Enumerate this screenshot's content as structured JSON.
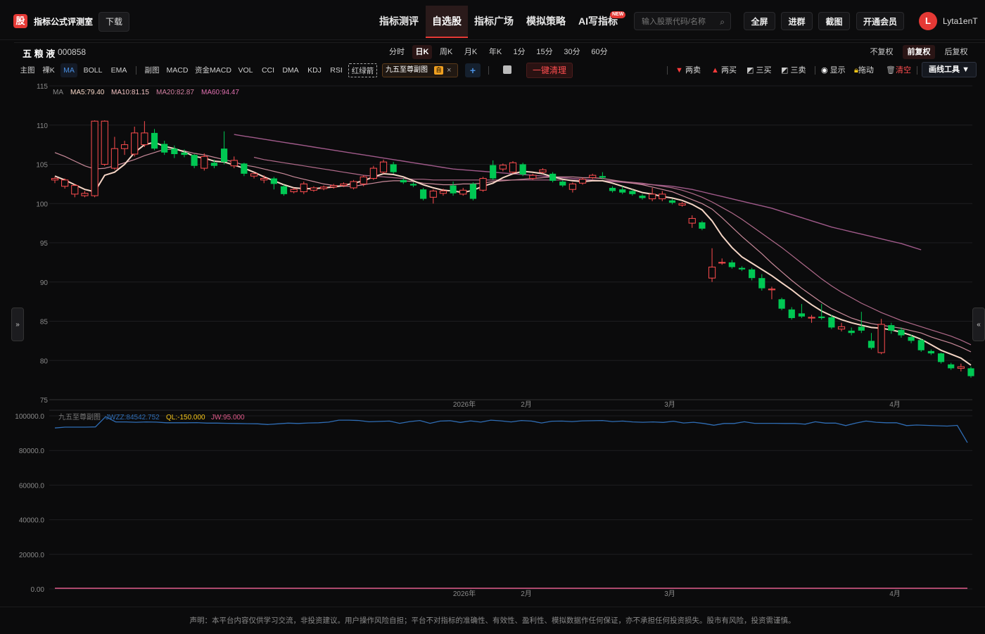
{
  "header": {
    "logo_char": "股",
    "brand": "指标公式评测室",
    "download": "下载",
    "nav": [
      "指标测评",
      "自选股",
      "指标广场",
      "模拟策略",
      "AI写指标"
    ],
    "active_nav": 1,
    "new_badge": "NEW",
    "search_placeholder": "输入股票代码/名称",
    "buttons": [
      "全屏",
      "进群",
      "截图",
      "开通会员"
    ],
    "avatar_letter": "L",
    "username": "Lyta1enT"
  },
  "stock": {
    "name": "五 粮 液",
    "code": "000858"
  },
  "periods": [
    "分时",
    "日K",
    "周K",
    "月K",
    "年K",
    "1分",
    "15分",
    "30分",
    "60分"
  ],
  "active_period": 1,
  "adjust": [
    "不复权",
    "前复权",
    "后复权"
  ],
  "active_adjust": 1,
  "indicators": [
    "主图",
    "裸K",
    "MA",
    "BOLL",
    "EMA",
    "副图",
    "MACD",
    "资金MACD",
    "VOL",
    "CCI",
    "DMA",
    "KDJ",
    "RSI",
    "红绿箭"
  ],
  "active_indicator": 2,
  "chip": {
    "label": "九五至尊副图",
    "tag": "自"
  },
  "clear_all": "一键清理",
  "tools": [
    "两卖",
    "两买",
    "三买",
    "三卖",
    "显示",
    "拖动",
    "清空"
  ],
  "draw_tools": "画线工具 ▼",
  "ma_legend": {
    "label": "MA",
    "ma5": "MA5:79.40",
    "ma10": "MA10:81.15",
    "ma20": "MA20:82.87",
    "ma60": "MA60:94.47"
  },
  "sub_legend": {
    "label": "九五至尊副图",
    "jwzz": "JWZZ:84542.752",
    "ql": "QL:-150.000",
    "jw": "JW:95.000"
  },
  "colors": {
    "up": "#ff4d4f",
    "down": "#00c853",
    "ma5": "#f5d5c5",
    "ma10": "#c98a9a",
    "ma20": "#b06a8a",
    "ma60": "#a05a8a",
    "jwzz": "#2f6db5",
    "ql": "#f5c518",
    "jw": "#e05a8a"
  },
  "chart_data": [
    {
      "type": "candlestick",
      "y_ticks": [
        115,
        110,
        105,
        100,
        95,
        90,
        85,
        80,
        75
      ],
      "ylim": [
        75,
        115
      ],
      "x_labels": [
        "2026年",
        "2月",
        "3月",
        "4月"
      ],
      "candles": [
        [
          103.0,
          103.2,
          102.6,
          103.4
        ],
        [
          102.2,
          103.0,
          101.9,
          103.2
        ],
        [
          101.2,
          102.3,
          100.8,
          102.5
        ],
        [
          101.0,
          101.3,
          100.8,
          101.6
        ],
        [
          101.0,
          110.5,
          100.8,
          110.6
        ],
        [
          105.0,
          110.5,
          104.8,
          110.6
        ],
        [
          104.5,
          107.0,
          104.3,
          108.5
        ],
        [
          107.0,
          107.5,
          106.2,
          108.0
        ],
        [
          106.3,
          109.0,
          106.0,
          109.8
        ],
        [
          107.5,
          109.0,
          107.2,
          110.5
        ],
        [
          109.0,
          107.0,
          106.8,
          109.5
        ],
        [
          107.6,
          106.5,
          106.2,
          108.0
        ],
        [
          107.0,
          106.3,
          105.8,
          107.4
        ],
        [
          106.5,
          106.2,
          105.9,
          106.9
        ],
        [
          106.2,
          104.8,
          104.5,
          106.3
        ],
        [
          104.5,
          106.0,
          104.2,
          106.4
        ],
        [
          105.2,
          104.8,
          104.5,
          105.6
        ],
        [
          107.0,
          105.3,
          105.0,
          109.2
        ],
        [
          104.8,
          105.5,
          104.5,
          106.0
        ],
        [
          105.1,
          103.8,
          103.5,
          105.2
        ],
        [
          103.5,
          103.8,
          103.2,
          104.0
        ],
        [
          103.0,
          103.2,
          102.6,
          103.6
        ],
        [
          103.2,
          102.5,
          101.8,
          103.4
        ],
        [
          102.2,
          101.2,
          101.0,
          102.4
        ],
        [
          101.5,
          101.8,
          101.3,
          102.0
        ],
        [
          101.5,
          102.5,
          101.2,
          102.8
        ],
        [
          101.7,
          102.0,
          101.5,
          102.2
        ],
        [
          101.9,
          102.1,
          101.7,
          102.3
        ],
        [
          102.1,
          102.3,
          101.9,
          102.5
        ],
        [
          102.3,
          102.5,
          102.1,
          102.7
        ],
        [
          102.0,
          102.8,
          101.8,
          103.0
        ],
        [
          102.5,
          103.4,
          102.2,
          103.6
        ],
        [
          103.2,
          104.5,
          103.0,
          104.8
        ],
        [
          104.0,
          105.3,
          103.8,
          105.6
        ],
        [
          105.0,
          104.0,
          103.8,
          105.3
        ],
        [
          103.0,
          102.7,
          102.5,
          103.2
        ],
        [
          102.5,
          102.3,
          102.1,
          102.7
        ],
        [
          101.8,
          100.6,
          100.4,
          102.0
        ],
        [
          100.8,
          101.6,
          100.0,
          101.8
        ],
        [
          101.3,
          101.6,
          101.0,
          101.9
        ],
        [
          102.3,
          101.3,
          101.0,
          102.8
        ],
        [
          101.2,
          101.7,
          101.0,
          102.0
        ],
        [
          102.5,
          100.6,
          100.4,
          102.7
        ],
        [
          101.7,
          103.2,
          101.5,
          103.4
        ],
        [
          104.9,
          103.2,
          103.0,
          105.5
        ],
        [
          104.4,
          104.9,
          104.1,
          105.1
        ],
        [
          104.0,
          105.2,
          103.8,
          105.4
        ],
        [
          105.0,
          103.7,
          103.5,
          105.2
        ],
        [
          103.2,
          103.6,
          103.0,
          103.8
        ],
        [
          104.0,
          104.3,
          103.8,
          104.5
        ],
        [
          103.8,
          102.9,
          102.7,
          104.0
        ],
        [
          102.8,
          102.3,
          102.1,
          103.0
        ],
        [
          101.8,
          102.5,
          101.4,
          102.7
        ],
        [
          102.6,
          103.1,
          102.4,
          103.3
        ],
        [
          103.3,
          103.6,
          103.1,
          103.8
        ],
        [
          103.5,
          103.3,
          103.1,
          104.0
        ],
        [
          102.0,
          101.6,
          101.4,
          102.2
        ],
        [
          101.8,
          101.4,
          101.2,
          102.2
        ],
        [
          101.6,
          101.2,
          101.0,
          101.8
        ],
        [
          101.0,
          100.7,
          100.5,
          101.2
        ],
        [
          100.6,
          101.2,
          100.3,
          102.0
        ],
        [
          100.6,
          101.2,
          100.3,
          101.6
        ],
        [
          100.4,
          100.1,
          99.9,
          100.6
        ],
        [
          99.8,
          100.0,
          99.6,
          100.2
        ],
        [
          97.5,
          98.1,
          96.9,
          98.5
        ],
        [
          97.6,
          96.8,
          96.6,
          97.8
        ],
        [
          90.5,
          91.9,
          90.0,
          94.3
        ],
        [
          92.5,
          92.5,
          92.2,
          93.0
        ],
        [
          92.5,
          91.9,
          91.7,
          92.8
        ],
        [
          91.8,
          91.6,
          91.4,
          92.0
        ],
        [
          91.6,
          90.5,
          90.2,
          91.8
        ],
        [
          90.5,
          89.2,
          88.9,
          91.0
        ],
        [
          89.0,
          89.1,
          87.8,
          89.4
        ],
        [
          87.8,
          86.6,
          86.4,
          88.0
        ],
        [
          86.5,
          85.4,
          85.2,
          86.8
        ],
        [
          86.0,
          85.6,
          85.4,
          87.2
        ],
        [
          85.4,
          85.5,
          84.8,
          85.8
        ],
        [
          85.6,
          85.4,
          85.2,
          87.2
        ],
        [
          85.5,
          84.2,
          84.0,
          85.8
        ],
        [
          84.0,
          84.3,
          83.7,
          84.8
        ],
        [
          83.8,
          83.5,
          83.2,
          84.2
        ],
        [
          84.3,
          83.8,
          83.5,
          86.2
        ],
        [
          82.5,
          81.6,
          81.4,
          83.5
        ],
        [
          81.0,
          84.6,
          80.8,
          85.3
        ],
        [
          84.5,
          83.8,
          83.4,
          84.8
        ],
        [
          83.9,
          83.2,
          82.9,
          84.2
        ],
        [
          83.0,
          82.5,
          82.2,
          83.3
        ],
        [
          82.6,
          81.3,
          81.1,
          82.8
        ],
        [
          81.2,
          80.9,
          80.7,
          81.4
        ],
        [
          80.9,
          79.8,
          79.6,
          81.0
        ],
        [
          79.5,
          79.0,
          78.8,
          79.7
        ],
        [
          79.0,
          79.2,
          78.6,
          79.6
        ],
        [
          79.0,
          78.0,
          77.8,
          79.2
        ]
      ],
      "ma5": [
        103.5,
        103.0,
        102.4,
        101.8,
        101.5,
        103.6,
        104.0,
        105.0,
        106.5,
        107.5,
        107.8,
        107.3,
        107.0,
        106.6,
        106.0,
        105.8,
        105.4,
        105.3,
        104.9,
        104.5,
        104.0,
        103.4,
        102.9,
        102.4,
        102.0,
        101.9,
        101.9,
        102.0,
        102.1,
        102.3,
        102.6,
        102.9,
        103.4,
        103.8,
        103.7,
        103.4,
        102.9,
        102.4,
        102.0,
        101.7,
        101.6,
        101.4,
        101.7,
        102.2,
        102.6,
        103.3,
        103.8,
        104.1,
        104.0,
        103.8,
        103.4,
        103.1,
        102.9,
        102.8,
        102.9,
        102.9,
        102.6,
        102.2,
        101.8,
        101.4,
        101.2,
        100.9,
        100.7,
        100.4,
        99.9,
        99.2,
        97.8,
        95.9,
        94.4,
        93.2,
        92.4,
        91.6,
        90.8,
        89.9,
        89.0,
        88.0,
        87.1,
        86.3,
        85.7,
        85.2,
        84.8,
        84.5,
        84.2,
        84.1,
        83.9,
        83.6,
        83.2,
        82.7,
        82.0,
        81.3,
        80.8,
        80.3,
        79.4
      ],
      "ma10": [
        106.5,
        106.0,
        105.4,
        104.8,
        104.4,
        104.5,
        104.8,
        105.2,
        105.6,
        106.1,
        106.5,
        106.9,
        106.9,
        106.7,
        106.4,
        106.2,
        105.9,
        105.6,
        105.3,
        104.9,
        104.7,
        104.4,
        104.1,
        103.8,
        103.4,
        103.1,
        102.8,
        102.5,
        102.3,
        102.2,
        102.2,
        102.4,
        102.6,
        102.8,
        102.9,
        102.9,
        102.8,
        102.6,
        102.5,
        102.4,
        102.4,
        102.5,
        102.5,
        102.6,
        102.8,
        102.9,
        103.0,
        103.1,
        103.2,
        103.3,
        103.4,
        103.4,
        103.4,
        103.3,
        103.3,
        103.2,
        103.0,
        102.8,
        102.6,
        102.4,
        102.1,
        101.8,
        101.5,
        101.0,
        100.5,
        100.0,
        99.3,
        98.2,
        97.0,
        95.8,
        94.7,
        93.6,
        92.4,
        91.3,
        90.2,
        89.2,
        88.3,
        87.4,
        86.6,
        86.0,
        85.4,
        85.0,
        84.7,
        84.5,
        84.3,
        84.1,
        83.8,
        83.5,
        83.0,
        82.6,
        82.2,
        81.7,
        81.1
      ],
      "ma20": [
        null,
        null,
        null,
        null,
        null,
        null,
        null,
        null,
        null,
        null,
        null,
        null,
        null,
        null,
        null,
        null,
        null,
        null,
        null,
        null,
        105.9,
        105.6,
        105.4,
        105.2,
        105.0,
        104.8,
        104.6,
        104.4,
        104.2,
        104.0,
        103.8,
        103.6,
        103.5,
        103.4,
        103.3,
        103.2,
        103.1,
        103.1,
        103.0,
        103.0,
        103.0,
        103.0,
        103.0,
        103.0,
        103.0,
        103.0,
        103.0,
        103.0,
        103.0,
        103.0,
        103.0,
        103.0,
        103.0,
        102.9,
        102.9,
        102.9,
        102.9,
        102.8,
        102.7,
        102.6,
        102.4,
        102.2,
        102.0,
        101.7,
        101.3,
        100.8,
        100.2,
        99.5,
        98.8,
        98.0,
        97.1,
        96.2,
        95.3,
        94.4,
        93.4,
        92.4,
        91.4,
        90.4,
        89.5,
        88.7,
        88.0,
        87.3,
        86.7,
        86.1,
        85.6,
        85.1,
        84.7,
        84.3,
        83.9,
        83.5,
        83.1,
        82.6,
        82.0
      ],
      "ma60": [
        null,
        null,
        null,
        null,
        null,
        null,
        null,
        null,
        null,
        null,
        null,
        null,
        null,
        null,
        null,
        null,
        null,
        null,
        108.8,
        108.6,
        108.4,
        108.2,
        108.0,
        107.8,
        107.6,
        107.4,
        107.2,
        107.0,
        106.8,
        106.6,
        106.4,
        106.2,
        106.0,
        105.8,
        105.6,
        105.4,
        105.2,
        105.0,
        104.8,
        104.6,
        104.4,
        104.3,
        104.2,
        104.1,
        104.0,
        103.9,
        103.8,
        103.7,
        103.6,
        103.5,
        103.4,
        103.3,
        103.2,
        103.1,
        103.0,
        102.9,
        102.8,
        102.7,
        102.6,
        102.5,
        102.4,
        102.3,
        102.2,
        102.0,
        101.8,
        101.5,
        101.2,
        100.9,
        100.6,
        100.3,
        100.0,
        99.7,
        99.4,
        99.0,
        98.6,
        98.2,
        97.8,
        97.4,
        97.0,
        96.7,
        96.4,
        96.1,
        95.8,
        95.5,
        95.2,
        94.9,
        94.5,
        94.1
      ]
    },
    {
      "type": "line",
      "y_ticks": [
        100000.0,
        80000.0,
        60000.0,
        40000.0,
        20000.0,
        0.0
      ],
      "y_tick_labels": [
        "100000.0",
        "80000.0",
        "60000.0",
        "40000.0",
        "20000.0",
        "0.00"
      ],
      "ylim": [
        0,
        100000
      ],
      "x_labels": [
        "2026年",
        "2月",
        "3月",
        "4月"
      ],
      "jwzz": [
        93000,
        93500,
        93500,
        93500,
        93600,
        99500,
        96500,
        96500,
        96300,
        96500,
        96400,
        96000,
        96000,
        96000,
        96100,
        95800,
        95800,
        95700,
        95600,
        95500,
        95400,
        95000,
        95400,
        95800,
        95600,
        95900,
        96000,
        96400,
        97500,
        97500,
        97300,
        96600,
        96800,
        97000,
        95700,
        96700,
        97300,
        95700,
        97000,
        97200,
        96200,
        97100,
        96400,
        97500,
        97100,
        96500,
        97300,
        97000,
        95900,
        96900,
        97000,
        96700,
        97100,
        97200,
        97300,
        96700,
        97000,
        96500,
        96300,
        96500,
        96200,
        96900,
        95900,
        96300,
        95600,
        94600,
        95600,
        95600,
        96600,
        95700,
        95700,
        95700,
        95600,
        95600,
        95200,
        96600,
        95800,
        95800,
        94400,
        95800,
        97000,
        96300,
        96000,
        96000,
        94400,
        94700,
        94500,
        94300,
        94100,
        94500,
        84500
      ],
      "ql": [
        0,
        0,
        0,
        0,
        0,
        0,
        0,
        0,
        0,
        0,
        0,
        0,
        0,
        0,
        0,
        0,
        0,
        0,
        0,
        0,
        0,
        0,
        0,
        0,
        0,
        0,
        0,
        0,
        0,
        0,
        0,
        0,
        0,
        0,
        0,
        0,
        0,
        0,
        0,
        0,
        0,
        0,
        0,
        0,
        0,
        0,
        0,
        0,
        0,
        0,
        0,
        0,
        0,
        0,
        0,
        0,
        0,
        0,
        0,
        0,
        0,
        0,
        0,
        0,
        0,
        0,
        0,
        0,
        0,
        0,
        0,
        0,
        0,
        0,
        0,
        0,
        0,
        0,
        0,
        0,
        0,
        0,
        0,
        0,
        0,
        0,
        0,
        0,
        0,
        0,
        0
      ]
    }
  ]
}
